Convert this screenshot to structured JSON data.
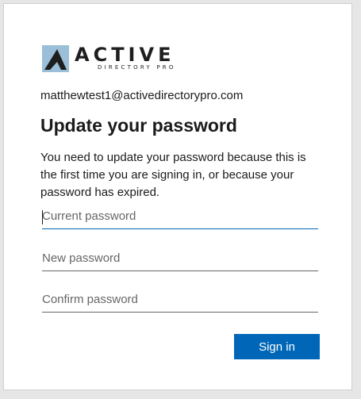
{
  "logo": {
    "main": "ACTIVE",
    "sub": "DIRECTORY PRO",
    "colors": {
      "dark": "#1e1e1e",
      "light": "#9bbfd8"
    }
  },
  "account": {
    "email": "matthewtest1@activedirectorypro.com"
  },
  "heading": "Update your password",
  "description": "You need to update your password because this is the first time you are signing in, or because your password has expired.",
  "fields": {
    "current_password": {
      "placeholder": "Current password",
      "value": ""
    },
    "new_password": {
      "placeholder": "New password",
      "value": ""
    },
    "confirm_password": {
      "placeholder": "Confirm password",
      "value": ""
    }
  },
  "actions": {
    "sign_in_label": "Sign in"
  },
  "colors": {
    "accent": "#0067b8",
    "text": "#1b1b1b",
    "placeholder": "#666666",
    "background": "#ffffff"
  }
}
